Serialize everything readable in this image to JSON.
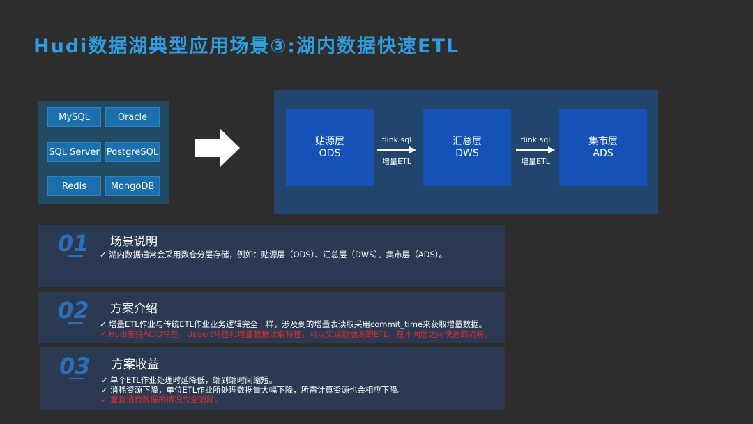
{
  "title": "Hudi数据湖典型应用场景③:湖内数据快速ETL",
  "sources": [
    "MySQL",
    "Oracle",
    "SQL Server",
    "PostgreSQL",
    "Redis",
    "MongoDB"
  ],
  "layers": [
    {
      "name": "贴源层",
      "code": "ODS"
    },
    {
      "name": "汇总层",
      "code": "DWS"
    },
    {
      "name": "集市层",
      "code": "ADS"
    }
  ],
  "connectors": [
    {
      "top": "flink sql",
      "bottom": "增量ETL"
    },
    {
      "top": "flink sql",
      "bottom": "增量ETL"
    }
  ],
  "cards": [
    {
      "number": "01",
      "heading": "场景说明",
      "lines": [
        {
          "text": "湖内数据通常会采用数仓分层存储，例如：贴源层（ODS）、汇总层（DWS）、集市层（ADS）。",
          "red": false
        }
      ]
    },
    {
      "number": "02",
      "heading": "方案介绍",
      "lines": [
        {
          "text": "增量ETL作业与传统ETL作业业务逻辑完全一样，涉及到的增量表读取采用commit_time来获取增量数据。",
          "red": false
        },
        {
          "text": "Hudi支持ACID特性，Upsert特性和增量数据读取特性，可以实现数据湖的ETL，在不同层之间快速的流转。",
          "red": true
        }
      ]
    },
    {
      "number": "03",
      "heading": "方案收益",
      "lines": [
        {
          "text": "单个ETL作业处理时延降低，端到端时间缩短。",
          "red": false
        },
        {
          "text": "消耗资源下降，单位ETL作业所处理数据量大幅下降，所需计算资源也会相应下降。",
          "red": false
        },
        {
          "text": "重复消费数据的情况完全消除。",
          "red": true
        }
      ]
    }
  ],
  "colors": {
    "accent": "#2f9ee0",
    "layer": "#1452b8",
    "warn": "#d9302a"
  }
}
